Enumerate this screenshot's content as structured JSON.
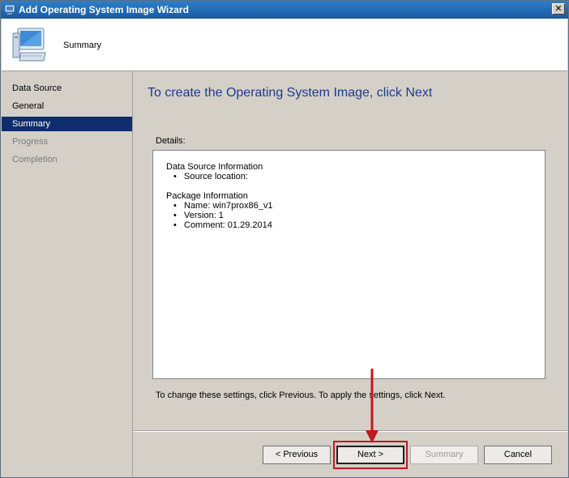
{
  "window": {
    "title": "Add Operating System Image Wizard",
    "close_label": "✕"
  },
  "header": {
    "title": "Summary",
    "icon": "computer-icon"
  },
  "nav": {
    "items": [
      {
        "label": "Data Source",
        "state": "normal"
      },
      {
        "label": "General",
        "state": "normal"
      },
      {
        "label": "Summary",
        "state": "selected"
      },
      {
        "label": "Progress",
        "state": "disabled"
      },
      {
        "label": "Completion",
        "state": "disabled"
      }
    ]
  },
  "main": {
    "heading": "To create the Operating System Image, click Next",
    "details_label": "Details:",
    "data_source": {
      "title": "Data Source Information",
      "items": [
        "Source location:"
      ]
    },
    "package": {
      "title": "Package Information",
      "items": [
        "Name: win7prox86_v1",
        "Version: 1",
        "Comment: 01.29.2014"
      ]
    },
    "hint": "To change these settings, click Previous. To apply the settings, click Next."
  },
  "buttons": {
    "previous": "< Previous",
    "next": "Next >",
    "summary": "Summary",
    "cancel": "Cancel"
  },
  "colors": {
    "annotation": "#c0181f",
    "selected_nav": "#0f2d6e",
    "heading": "#1c3c8c"
  }
}
